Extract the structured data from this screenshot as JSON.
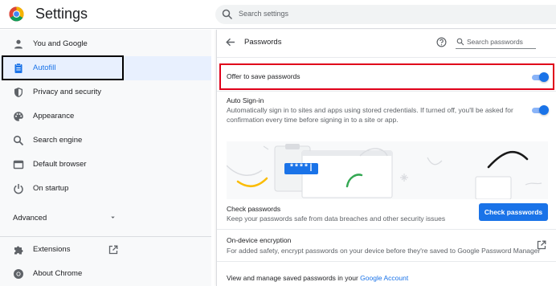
{
  "header": {
    "app_title": "Settings",
    "search_placeholder": "Search settings"
  },
  "sidebar": {
    "items": [
      {
        "label": "You and Google",
        "icon": "person-icon"
      },
      {
        "label": "Autofill",
        "icon": "clipboard-icon",
        "active": true
      },
      {
        "label": "Privacy and security",
        "icon": "shield-icon"
      },
      {
        "label": "Appearance",
        "icon": "palette-icon"
      },
      {
        "label": "Search engine",
        "icon": "search-icon"
      },
      {
        "label": "Default browser",
        "icon": "browser-icon"
      },
      {
        "label": "On startup",
        "icon": "power-icon"
      }
    ],
    "advanced_label": "Advanced",
    "footer_items": [
      {
        "label": "Extensions",
        "icon": "puzzle-icon"
      },
      {
        "label": "About Chrome",
        "icon": "chrome-icon"
      }
    ]
  },
  "passwords": {
    "title": "Passwords",
    "search_placeholder": "Search passwords",
    "offer_to_save": {
      "label": "Offer to save passwords",
      "enabled": true
    },
    "auto_signin": {
      "label": "Auto Sign-in",
      "description_line1": "Automatically sign in to sites and apps using stored credentials. If turned off, you'll be asked for",
      "description_line2": "confirmation every time before signing in to a site or app.",
      "enabled": true
    },
    "illustration": {
      "masked_password": "****|"
    },
    "check": {
      "label": "Check passwords",
      "description": "Keep your passwords safe from data breaches and other security issues",
      "button_label": "Check passwords"
    },
    "encryption": {
      "label": "On-device encryption",
      "description": "For added safety, encrypt passwords on your device before they're saved to Google Password Manager"
    },
    "manage": {
      "text": "View and manage saved passwords in your ",
      "link": "Google Account"
    }
  },
  "colors": {
    "accent": "#1a73e8",
    "highlight_border": "#e0001a",
    "active_nav_bg": "#e8f0fe"
  }
}
